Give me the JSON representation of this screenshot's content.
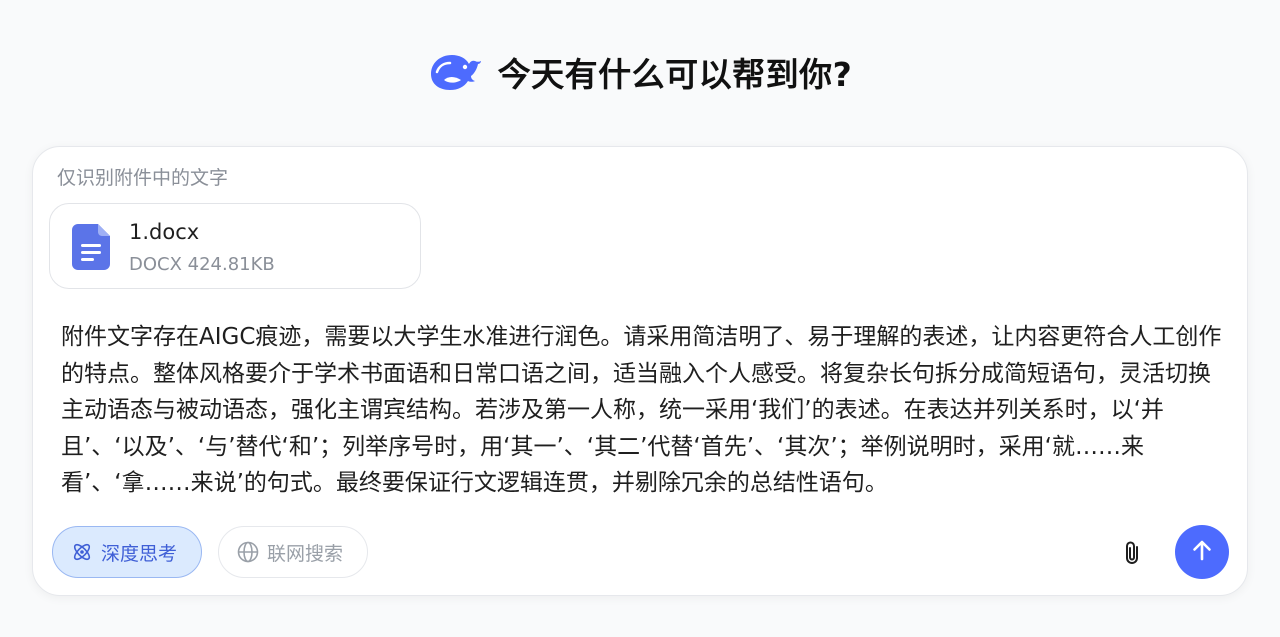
{
  "header": {
    "logo_icon": "deepseek-whale-logo",
    "greeting": "今天有什么可以帮到你?"
  },
  "composer": {
    "hint": "仅识别附件中的文字",
    "attachment": {
      "icon": "document-icon",
      "name": "1.docx",
      "meta": "DOCX 424.81KB"
    },
    "prompt": "附件文字存在AIGC痕迹，需要以大学生水准进行润色。请采用简洁明了、易于理解的表述，让内容更符合人工创作的特点。整体风格要介于学术书面语和日常口语之间，适当融入个人感受。将复杂长句拆分成简短语句，灵活切换主动语态与被动语态，强化主谓宾结构。若涉及第一人称，统一采用‘我们’的表述。在表达并列关系时，以‘并且’、‘以及’、‘与’替代‘和’；列举序号时，用‘其一’、‘其二’代替‘首先’、‘其次’；举例说明时，采用‘就……来看’、‘拿……来说’的句式。最终要保证行文逻辑连贯，并剔除冗余的总结性语句。",
    "toolbar": {
      "deep_think_label": "深度思考",
      "deep_think_icon": "atom-icon",
      "deep_think_active": true,
      "web_search_label": "联网搜索",
      "web_search_icon": "globe-icon",
      "web_search_active": false
    },
    "attach_icon": "paperclip-icon",
    "send_icon": "arrow-up-icon"
  },
  "colors": {
    "accent": "#4d6bfe",
    "active_pill_bg": "#dbeafe",
    "active_pill_text": "#3f5fd6",
    "muted_text": "#8a8f98"
  }
}
